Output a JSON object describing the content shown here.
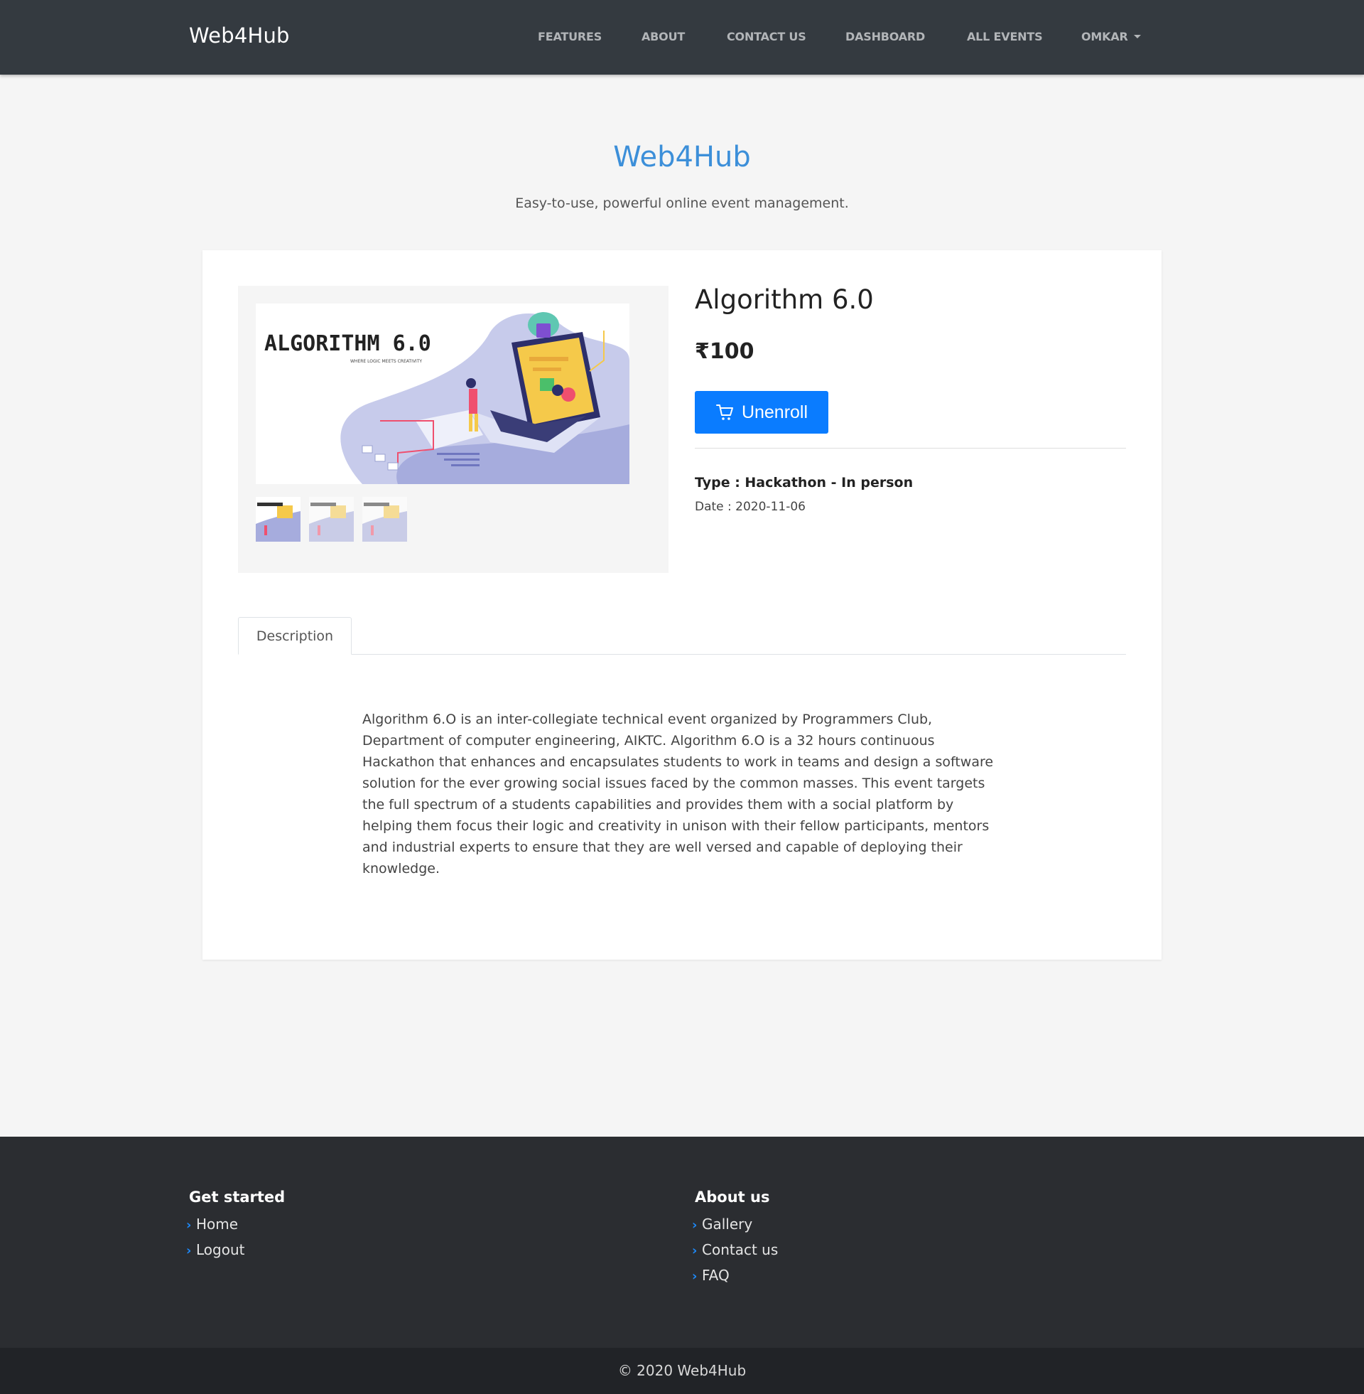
{
  "navbar": {
    "brand": "Web4Hub",
    "items": [
      {
        "label": "FEATURES"
      },
      {
        "label": "ABOUT"
      },
      {
        "label": "CONTACT US"
      },
      {
        "label": "DASHBOARD"
      },
      {
        "label": "ALL EVENTS"
      },
      {
        "label": "OMKAR"
      }
    ],
    "user_dropdown_icon": "caret-down-icon"
  },
  "hero": {
    "title": "Web4Hub",
    "subtitle": "Easy-to-use, powerful online event management."
  },
  "event": {
    "image_title_text": "ALGORITHM 6.0",
    "image_tagline_text": "WHERE LOGIC MEETS CREATIVITY",
    "title": "Algorithm 6.0",
    "price": "₹100",
    "action_label": "Unenroll",
    "action_icon": "cart-icon",
    "type": "Type : Hackathon - In person",
    "date": "Date : 2020-11-06",
    "thumbnail_count": 3
  },
  "tabs": [
    {
      "label": "Description",
      "active": true
    }
  ],
  "description": "Algorithm 6.O is an inter-collegiate technical event organized by Programmers Club, Department of computer engineering, AIKTC. Algorithm 6.O is a 32 hours continuous Hackathon that enhances and encapsulates students to work in teams and design a software solution for the ever growing social issues faced by the common masses. This event targets the full spectrum of a students capabilities and provides them with a social platform by helping them focus their logic and creativity in unison with their fellow participants, mentors and industrial experts to ensure that they are well versed and capable of deploying their knowledge.",
  "footer": {
    "get_started": {
      "heading": "Get started",
      "links": [
        {
          "label": "Home"
        },
        {
          "label": "Logout"
        }
      ]
    },
    "about_us": {
      "heading": "About us",
      "links": [
        {
          "label": "Gallery"
        },
        {
          "label": "Contact us"
        },
        {
          "label": "FAQ"
        }
      ]
    },
    "link_icon": "chevron-right-icon",
    "copyright": "© 2020 Web4Hub"
  },
  "colors": {
    "navbar_bg": "#343a40",
    "accent_blue": "#0a7cff",
    "hero_title": "#3c8fd9",
    "footer_bg": "#2b2d31",
    "copyright_bg": "#212327"
  }
}
